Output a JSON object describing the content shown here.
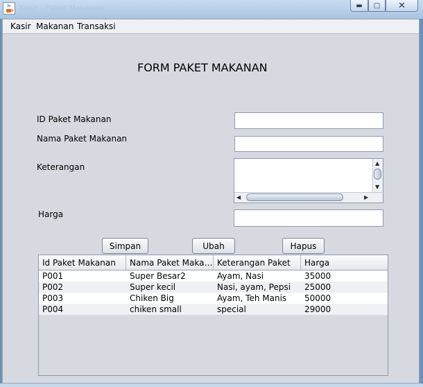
{
  "window": {
    "title": "Kasir - Paket Makanan"
  },
  "menubar": {
    "items": [
      "Kasir",
      "Makanan",
      "Transaksi"
    ]
  },
  "form": {
    "title": "FORM PAKET MAKANAN",
    "labels": {
      "id": "ID Paket Makanan",
      "nama": "Nama Paket Makanan",
      "keterangan": "Keterangan",
      "harga": "Harga"
    },
    "values": {
      "id": "",
      "nama": "",
      "keterangan": "",
      "harga": ""
    }
  },
  "buttons": {
    "simpan": "Simpan",
    "ubah": "Ubah",
    "hapus": "Hapus"
  },
  "table": {
    "columns": [
      "Id Paket Makanan",
      "Nama Paket Makan...",
      "Keterangan Paket",
      "Harga"
    ],
    "rows": [
      [
        "P001",
        "Super Besar2",
        "Ayam, Nasi",
        "35000"
      ],
      [
        "P002",
        "Super kecil",
        "Nasi, ayam, Pepsi",
        "25000"
      ],
      [
        "P003",
        "Chiken Big",
        "Ayam, Teh Manis",
        "50000"
      ],
      [
        "P004",
        "chiken small",
        "special",
        "29000"
      ]
    ]
  },
  "icons": {
    "app": "java-coffee-icon",
    "minimize": "minimize-icon",
    "maximize": "maximize-icon",
    "close": "close-icon"
  },
  "colors": {
    "window_bg": "#d6d9df",
    "titlebar": "#a9c4e3"
  }
}
